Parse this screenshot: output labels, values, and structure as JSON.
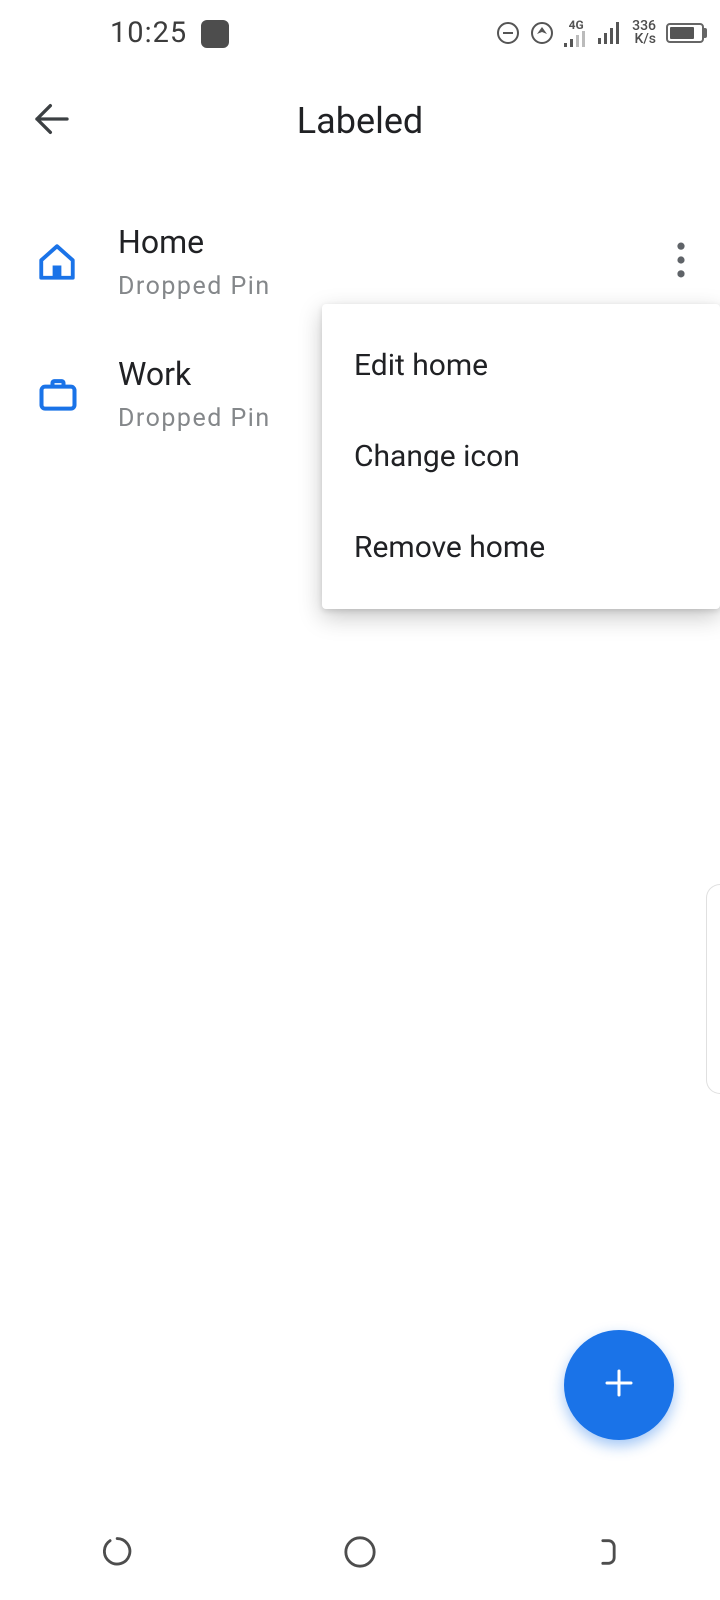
{
  "statusbar": {
    "time": "10:25",
    "net_speed_top": "336",
    "net_speed_bottom": "K/s",
    "mobile_gen": "4G"
  },
  "header": {
    "title": "Labeled"
  },
  "list": {
    "items": [
      {
        "icon": "home-icon",
        "title": "Home",
        "sub": "Dropped Pin"
      },
      {
        "icon": "briefcase-icon",
        "title": "Work",
        "sub": "Dropped Pin"
      }
    ]
  },
  "menu": {
    "items": [
      {
        "label": "Edit home"
      },
      {
        "label": "Change icon"
      },
      {
        "label": "Remove home"
      }
    ]
  },
  "colors": {
    "primary": "#1a73e8",
    "text": "#202124",
    "subtext": "#84878a"
  }
}
